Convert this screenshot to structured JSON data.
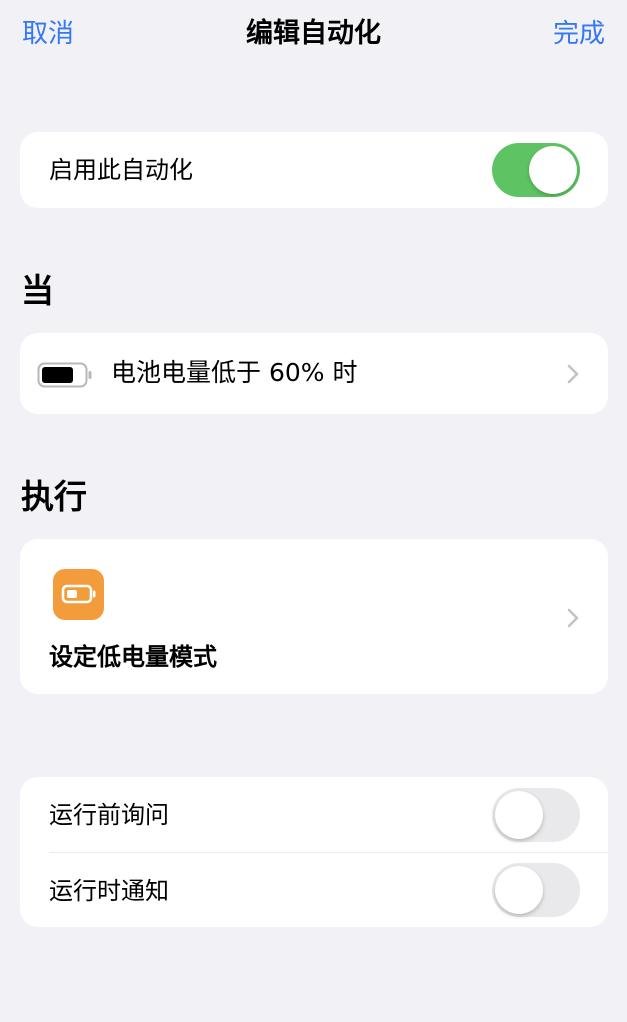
{
  "nav": {
    "cancel_label": "取消",
    "title": "编辑自动化",
    "done_label": "完成"
  },
  "enable": {
    "label": "启用此自动化",
    "enabled": true
  },
  "trigger_section": {
    "header": "当",
    "icon": "battery-icon",
    "label": "电池电量低于 60% 时"
  },
  "action_section": {
    "header": "执行",
    "icon": "low-power-mode-icon",
    "label": "设定低电量模式"
  },
  "options": [
    {
      "label": "运行前询问",
      "enabled": false
    },
    {
      "label": "运行时通知",
      "enabled": false
    }
  ],
  "colors": {
    "accent": "#3478f6",
    "toggle_on": "#5ec463",
    "action_icon_bg": "#f29c3b",
    "background": "#f2f1f6"
  }
}
